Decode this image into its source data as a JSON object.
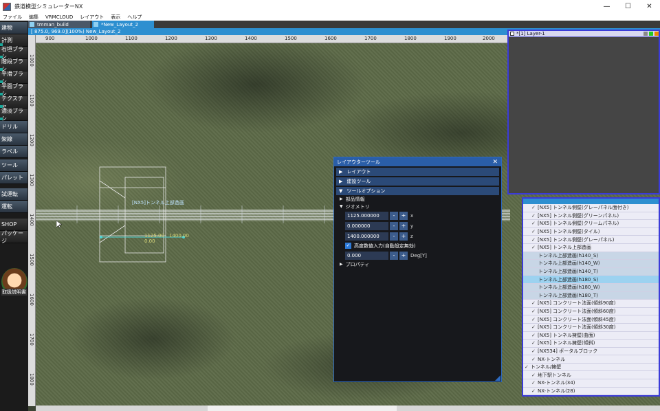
{
  "window": {
    "title": "鉄道模型シミュレーターNX",
    "minimize": "—",
    "maximize": "☐",
    "close": "✕"
  },
  "menu": [
    "ファイル",
    "編集",
    "VRMCLOUD",
    "レイアウト",
    "表示",
    "ヘルプ"
  ],
  "sidebar": [
    {
      "label": "建物"
    },
    {
      "label": "計測"
    },
    {
      "label": "石垣ブラシ"
    },
    {
      "label": "階段ブラシ"
    },
    {
      "label": "平滑ブラシ"
    },
    {
      "label": "平面ブラシ"
    },
    {
      "label": "テクスチャ"
    },
    {
      "label": "濃淡ブラシ"
    },
    {
      "label": "ドリル"
    },
    {
      "label": "架線"
    },
    {
      "label": "ラベル"
    },
    {
      "label": "ツール"
    },
    {
      "label": "パレット"
    },
    {
      "label": "試運転"
    },
    {
      "label": "運転"
    },
    {
      "label": "SHOP"
    },
    {
      "label": "パッケージ"
    }
  ],
  "mascot_label": "取扱説明書",
  "tabs": [
    {
      "label": "tmman_build"
    },
    {
      "label": "*New_Layout_2"
    }
  ],
  "status": "[ 875.0, 969.0](100%) New_Layout_2",
  "ruler_top": [
    "900",
    "1000",
    "1100",
    "1200",
    "1300",
    "1400",
    "1500",
    "1600",
    "1700",
    "1800",
    "1900",
    "2000"
  ],
  "ruler_left": [
    "1000",
    "1100",
    "1200",
    "1300",
    "1400",
    "1500",
    "1600",
    "1700",
    "1800"
  ],
  "layer_panel": {
    "layer_name": "*[1] Layer-1"
  },
  "tree": [
    {
      "label": "[NX5] トンネル側壁(グレーパネル面付き)",
      "kind": "item"
    },
    {
      "label": "[NX5] トンネル側壁(グリーンパネル)",
      "kind": "item"
    },
    {
      "label": "[NX5] トンネル側壁(クリームパネル)",
      "kind": "item"
    },
    {
      "label": "[NX5] トンネル側壁(タイル)",
      "kind": "item"
    },
    {
      "label": "[NX5] トンネル側壁(グレーパネル)",
      "kind": "item"
    },
    {
      "label": "[NX5] トンネル上部造画",
      "kind": "item"
    },
    {
      "label": "トンネル上部造画(h140_S)",
      "kind": "sub"
    },
    {
      "label": "トンネル上部造画(h140_W)",
      "kind": "sub"
    },
    {
      "label": "トンネル上部造画(h140_T)",
      "kind": "sub"
    },
    {
      "label": "トンネル上部造画(h180_S)",
      "kind": "sel"
    },
    {
      "label": "トンネル上部造画(h180_W)",
      "kind": "sub"
    },
    {
      "label": "トンネル上部造画(h180_T)",
      "kind": "sub"
    },
    {
      "label": "[NX5] コンクリート法面(傾斜90度)",
      "kind": "item"
    },
    {
      "label": "[NX5] コンクリート法面(傾斜60度)",
      "kind": "item"
    },
    {
      "label": "[NX5] コンクリート法面(傾斜45度)",
      "kind": "item"
    },
    {
      "label": "[NX5] コンクリート法面(傾斜30度)",
      "kind": "item"
    },
    {
      "label": "[NX5] トンネル擁壁(曲面)",
      "kind": "item"
    },
    {
      "label": "[NX5] トンネル擁壁(傾斜)",
      "kind": "item"
    },
    {
      "label": "[NX534] ポータルブロック",
      "kind": "item"
    },
    {
      "label": "NX-トンネル",
      "kind": "item"
    },
    {
      "label": "トンネル/擁壁",
      "kind": "group"
    },
    {
      "label": "地下駅トンネル",
      "kind": "item"
    },
    {
      "label": "NX-トンネル(34)",
      "kind": "item"
    },
    {
      "label": "NX-トンネル(28)",
      "kind": "item"
    }
  ],
  "tool_panel": {
    "title": "レイアウターツール",
    "close": "✕",
    "sections": {
      "layout": "レイアウト",
      "build": "建設ツール",
      "options": "ツールオプション"
    },
    "parts_info": "部品情報",
    "geometry": "ジオメトリ",
    "coords": [
      {
        "value": "1125.000000",
        "axis": "x"
      },
      {
        "value": "0.000000",
        "axis": "y"
      },
      {
        "value": "1400.000000",
        "axis": "z"
      }
    ],
    "height_check": "高度数値入力(自動設定無効)",
    "angle": {
      "value": "0.000",
      "unit": "Deg[Y]"
    },
    "property": "プロパティ",
    "minus": "-",
    "plus": "+",
    "check_mark": "✓"
  },
  "canvas_labels": {
    "track_label": "[NX5]トンネル上部造画",
    "coord_a": "1125.00",
    "coord_b": "0.00",
    "coord_c": "1400.00"
  },
  "colors": {
    "accent": "#2d8fd0",
    "panel_border": "#3b3bd8",
    "tool_header": "#2a5ea8"
  }
}
